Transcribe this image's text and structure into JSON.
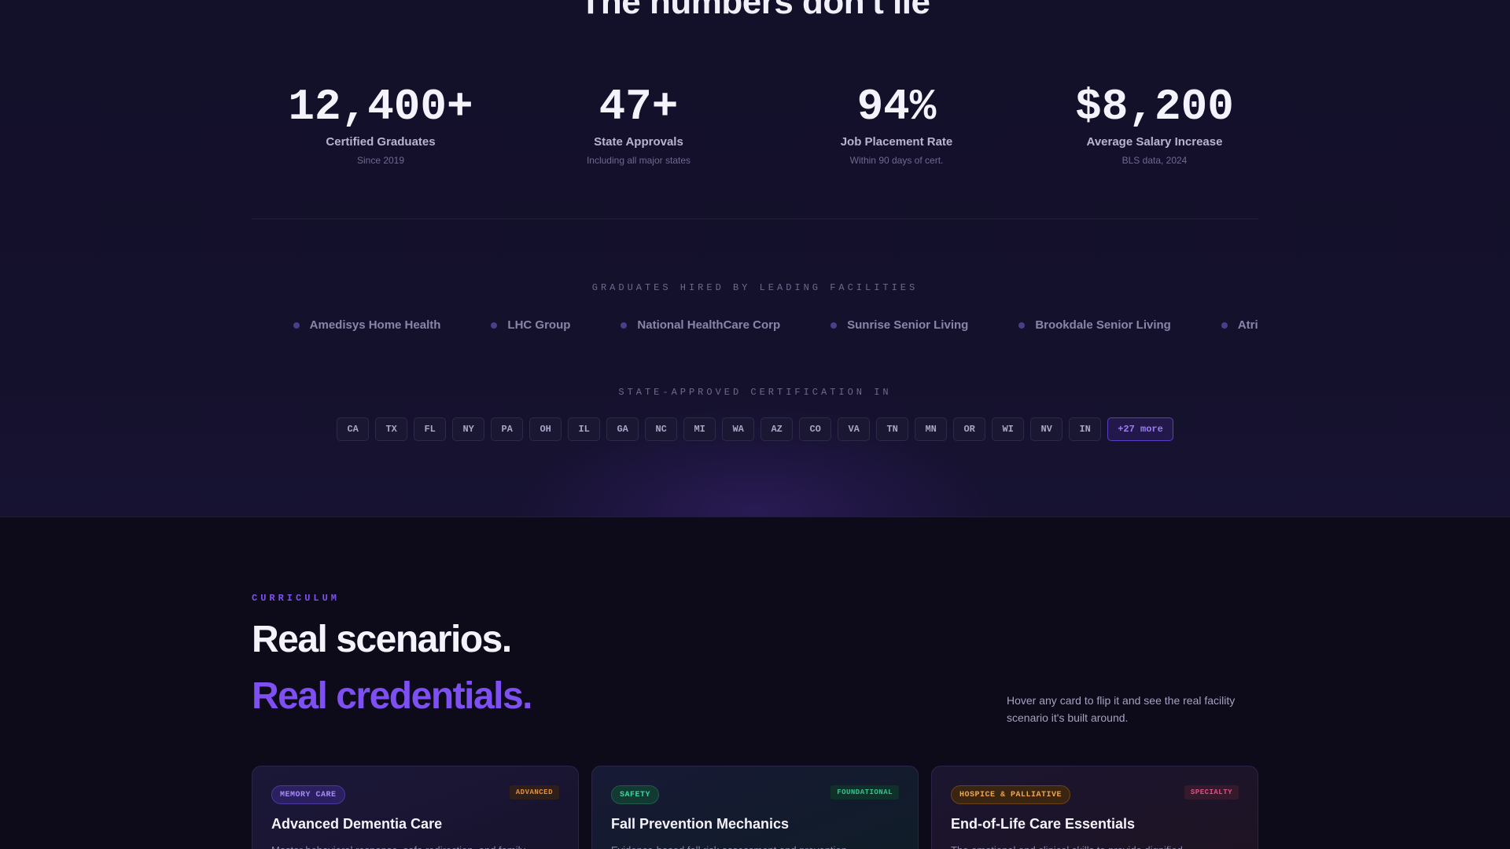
{
  "stats_section": {
    "heading": "The numbers don't lie",
    "stats": [
      {
        "value": "12,400+",
        "label": "Certified Graduates",
        "sub": "Since 2019"
      },
      {
        "value": "47+",
        "label": "State Approvals",
        "sub": "Including all major states"
      },
      {
        "value": "94%",
        "label": "Job Placement Rate",
        "sub": "Within 90 days of cert."
      },
      {
        "value": "$8,200",
        "label": "Average Salary Increase",
        "sub": "BLS data, 2024"
      }
    ],
    "hired_caption": "GRADUATES HIRED BY LEADING FACILITIES",
    "facilities": [
      "alth",
      "Amedisys Home Health",
      "LHC Group",
      "National HealthCare Corp",
      "Sunrise Senior Living",
      "Brookdale Senior Living",
      "Atria S"
    ],
    "cert_caption": "STATE-APPROVED CERTIFICATION IN",
    "states": [
      "CA",
      "TX",
      "FL",
      "NY",
      "PA",
      "OH",
      "IL",
      "GA",
      "NC",
      "MI",
      "WA",
      "AZ",
      "CO",
      "VA",
      "TN",
      "MN",
      "OR",
      "WI",
      "NV",
      "IN"
    ],
    "more_label": "+27 more"
  },
  "curriculum": {
    "eyebrow": "CURRICULUM",
    "headline_line1": "Real scenarios.",
    "headline_line2": "Real credentials.",
    "hint": "Hover any card to flip it and see the real facility scenario it's built around.",
    "cards": [
      {
        "tag": "MEMORY CARE",
        "level": "ADVANCED",
        "title": "Advanced Dementia Care",
        "desc": "Master behavioral response, safe redirection, and family"
      },
      {
        "tag": "SAFETY",
        "level": "FOUNDATIONAL",
        "title": "Fall Prevention Mechanics",
        "desc": "Evidence-based fall risk assessment and prevention"
      },
      {
        "tag": "HOSPICE & PALLIATIVE",
        "level": "SPECIALTY",
        "title": "End-of-Life Care Essentials",
        "desc": "The emotional and clinical skills to provide dignified"
      }
    ]
  },
  "colors": {
    "accent": "#7e4ff2",
    "section_bg": "#13102a",
    "page_bg": "#0d0a1a"
  }
}
